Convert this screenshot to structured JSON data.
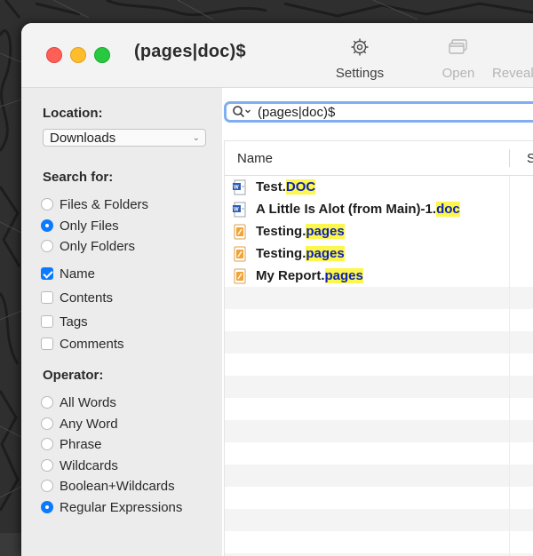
{
  "window": {
    "title": "(pages|doc)$",
    "toolbar": {
      "settings_label": "Settings",
      "open_label": "Open",
      "reveal_label": "Reveal"
    }
  },
  "sidebar": {
    "location_label": "Location:",
    "location_value": "Downloads",
    "search_for_label": "Search for:",
    "search_for_options": [
      "Files & Folders",
      "Only Files",
      "Only Folders"
    ],
    "search_for_selected": "Only Files",
    "fields": [
      {
        "label": "Name",
        "checked": true
      },
      {
        "label": "Contents",
        "checked": false
      },
      {
        "label": "Tags",
        "checked": false
      },
      {
        "label": "Comments",
        "checked": false
      }
    ],
    "operator_label": "Operator:",
    "operator_options": [
      "All Words",
      "Any Word",
      "Phrase",
      "Wildcards",
      "Boolean+Wildcards",
      "Regular Expressions"
    ],
    "operator_selected": "Regular Expressions"
  },
  "search": {
    "query": "(pages|doc)$"
  },
  "results": {
    "columns": [
      "Name",
      "S"
    ],
    "rows": [
      {
        "base": "Test.",
        "match": "DOC",
        "icon": "word-doc-icon"
      },
      {
        "base": "A Little Is Alot (from Main)-1.",
        "match": "doc",
        "icon": "word-doc-icon"
      },
      {
        "base": "Testing.",
        "match": "pages",
        "icon": "pages-doc-icon"
      },
      {
        "base": "Testing.",
        "match": "pages",
        "icon": "pages-doc-icon"
      },
      {
        "base": "My Report.",
        "match": "pages",
        "icon": "pages-doc-icon"
      }
    ]
  },
  "colors": {
    "accent": "#0a7aff",
    "highlight_bg": "#fdf64b",
    "highlight_text": "#0b22b8",
    "search_focus_ring": "#80aef0"
  }
}
